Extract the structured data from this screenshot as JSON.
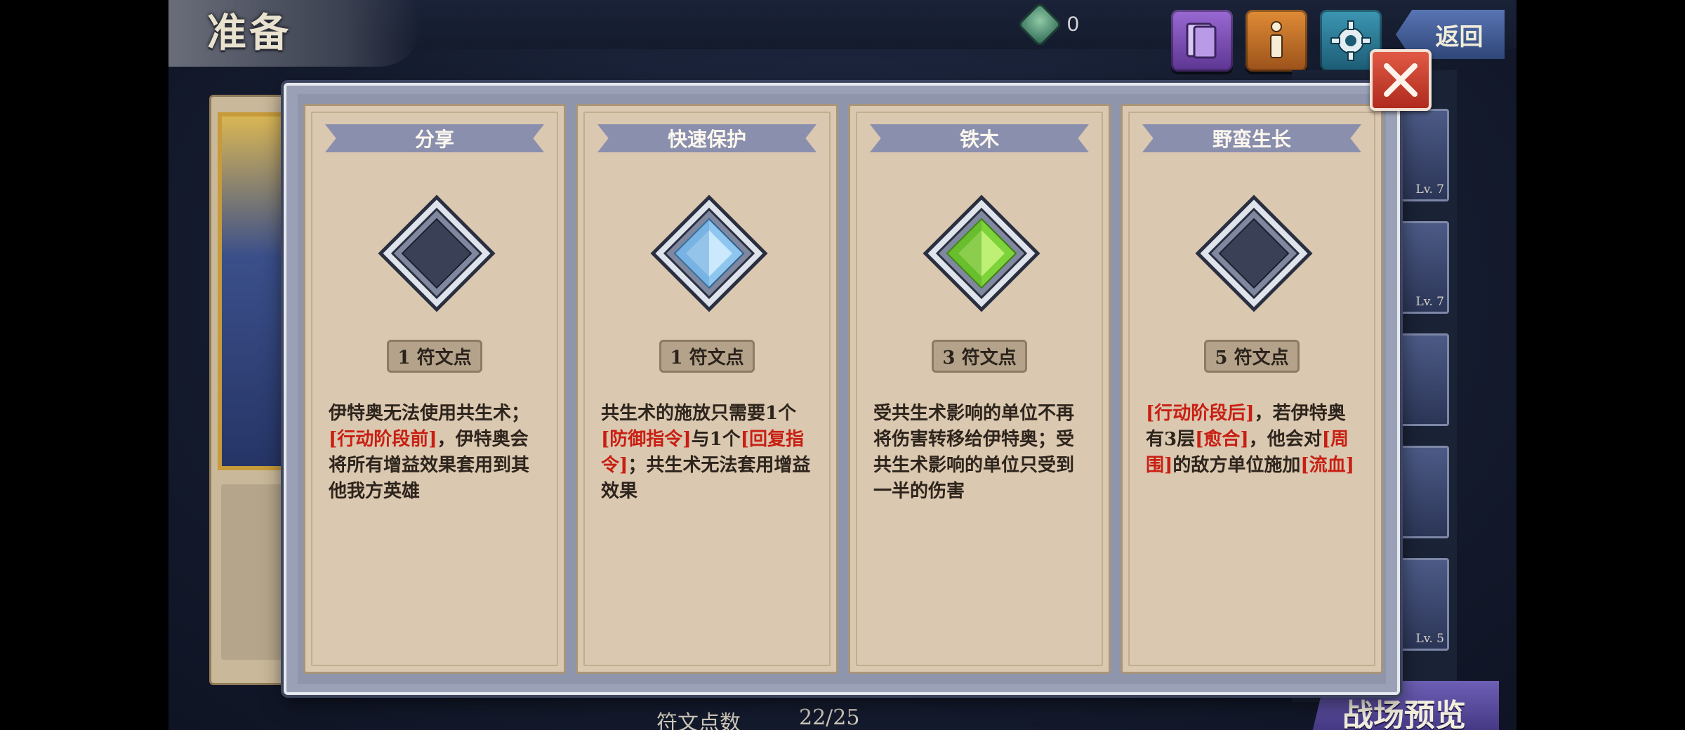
{
  "header": {
    "title": "准备",
    "currency_value": "0",
    "back_label": "返回"
  },
  "right_list": {
    "levels": [
      "Lv. 7",
      "Lv. 7",
      "",
      "",
      "Lv. 5"
    ]
  },
  "footer": {
    "rune_points_label": "符文点数",
    "rune_points_value": "22/25",
    "preview_label": "战场预览"
  },
  "cards": [
    {
      "title": "分享",
      "gem": "empty",
      "cost": "1 符文点",
      "desc_parts": [
        {
          "t": "伊特奥无法使用共生术；",
          "hl": false
        },
        {
          "t": "[行动阶段前]",
          "hl": true
        },
        {
          "t": "，伊特奥会将所有增益效果套用到其他我方英雄",
          "hl": false
        }
      ]
    },
    {
      "title": "快速保护",
      "gem": "blue",
      "cost": "1 符文点",
      "desc_parts": [
        {
          "t": "共生术的施放只需要1个",
          "hl": false
        },
        {
          "t": "[防御指令]",
          "hl": true
        },
        {
          "t": "与1个",
          "hl": false
        },
        {
          "t": "[回复指令]",
          "hl": true
        },
        {
          "t": "；共生术无法套用增益效果",
          "hl": false
        }
      ]
    },
    {
      "title": "铁木",
      "gem": "green",
      "cost": "3 符文点",
      "desc_parts": [
        {
          "t": "受共生术影响的单位不再将伤害转移给伊特奥；受共生术影响的单位只受到一半的伤害",
          "hl": false
        }
      ]
    },
    {
      "title": "野蛮生长",
      "gem": "empty",
      "cost": "5 符文点",
      "desc_parts": [
        {
          "t": "[行动阶段后]",
          "hl": true
        },
        {
          "t": "，若伊特奥有3层",
          "hl": false
        },
        {
          "t": "[愈合]",
          "hl": true
        },
        {
          "t": "，他会对",
          "hl": false
        },
        {
          "t": "[周围]",
          "hl": true
        },
        {
          "t": "的敌方单位施加",
          "hl": false
        },
        {
          "t": "[流血]",
          "hl": true
        }
      ]
    }
  ],
  "colors": {
    "highlight": "#c81f13",
    "gem_blue": "#8fc6ef",
    "gem_green": "#7ed33a",
    "gem_empty": "#3a4156"
  }
}
